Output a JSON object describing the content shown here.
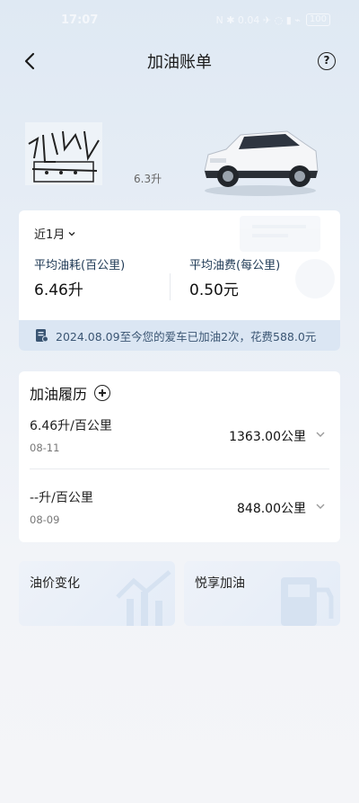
{
  "status_bar": {
    "time": "17:07",
    "indicators": "N ✱ 0.04 ✈ ◌ ▮ ⌁",
    "battery": "100"
  },
  "header": {
    "title": "加油账单",
    "help_glyph": "?"
  },
  "hero": {
    "fuel_display": "6.3升"
  },
  "stats": {
    "period": "近1月",
    "avg_consumption_label": "平均油耗(百公里)",
    "avg_consumption_value": "6.46升",
    "avg_cost_label": "平均油费(每公里)",
    "avg_cost_value": "0.50元",
    "summary": "2024.08.09至今您的爱车已加油2次，花费588.0元"
  },
  "history": {
    "title": "加油履历",
    "records": [
      {
        "rate": "6.46升/百公里",
        "date": "08-11",
        "distance": "1363.00公里"
      },
      {
        "rate": "--升/百公里",
        "date": "08-09",
        "distance": "848.00公里"
      }
    ]
  },
  "tiles": {
    "price_change": "油价变化",
    "enjoy_refuel": "悦享加油"
  },
  "colors": {
    "accent": "#1f3a56",
    "strip_bg": "#dbe6f3",
    "strip_text": "#3a5573"
  }
}
